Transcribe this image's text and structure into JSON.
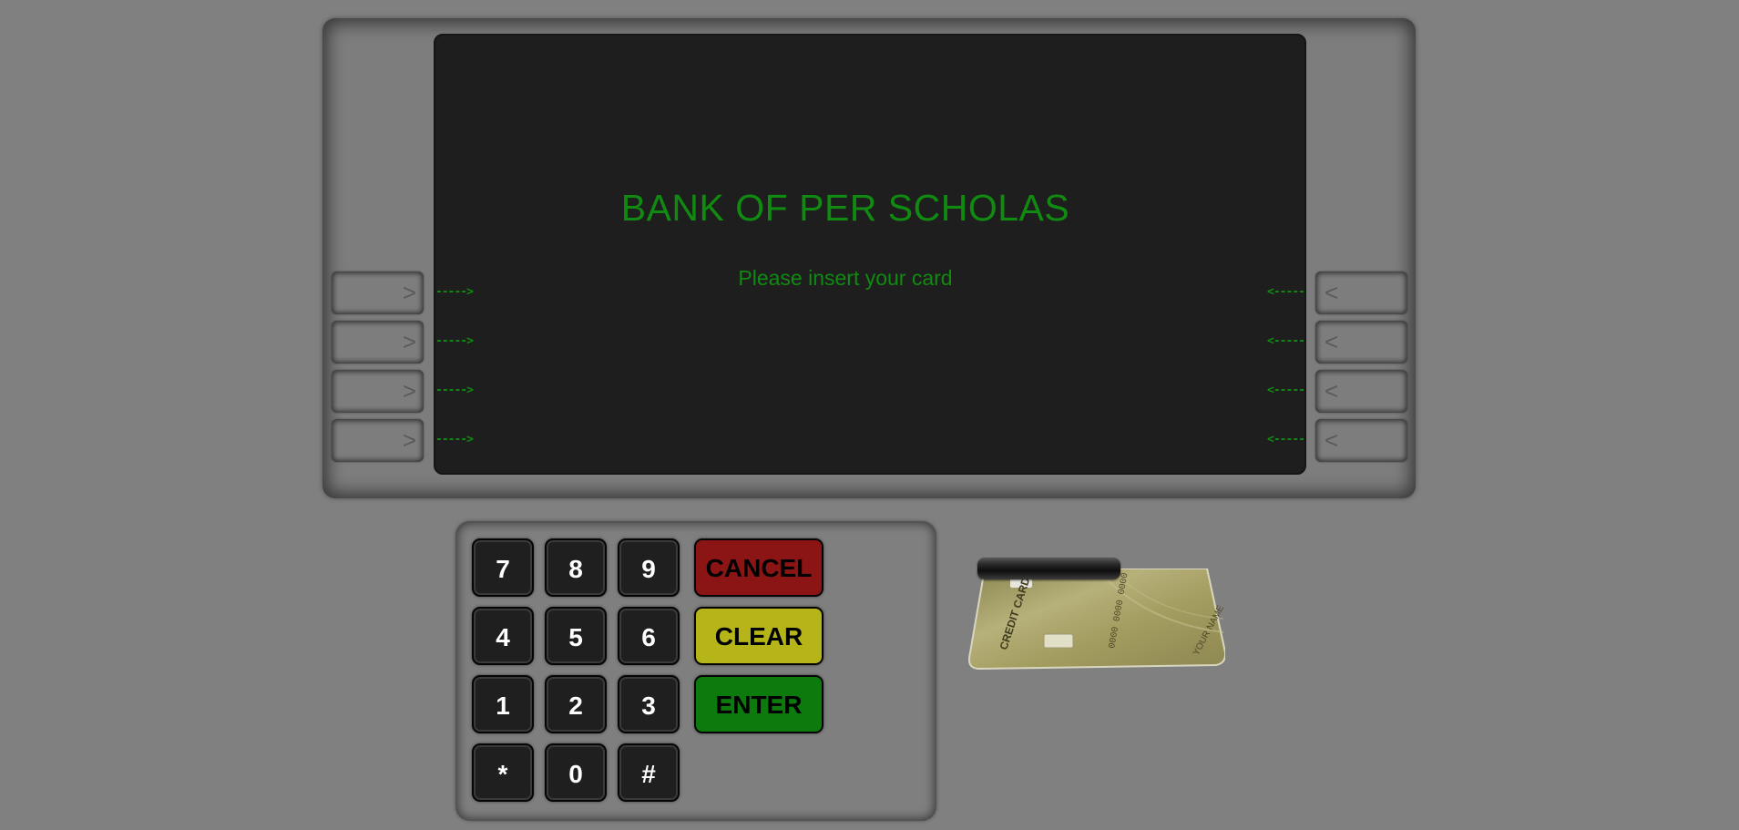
{
  "screen": {
    "title": "BANK OF PER SCHOLAS",
    "message": "Please insert your card",
    "left_arrow": "----->",
    "right_arrow": "<-----"
  },
  "side_buttons": {
    "left_glyph": ">",
    "right_glyph": "<"
  },
  "keypad": {
    "digits": [
      "7",
      "8",
      "9",
      "4",
      "5",
      "6",
      "1",
      "2",
      "3",
      "*",
      "0",
      "#"
    ],
    "cancel": "CANCEL",
    "clear": "CLEAR",
    "enter": "ENTER"
  },
  "card": {
    "brand": "CREDIT CARD",
    "number": "0000 0000 0000 0000",
    "holder": "YOUR NAME"
  },
  "colors": {
    "background": "#808080",
    "screen": "#1e1e1e",
    "screen_text": "#108a10",
    "cancel": "#8b1414",
    "clear": "#b5b51a",
    "enter": "#0d7a0d"
  }
}
